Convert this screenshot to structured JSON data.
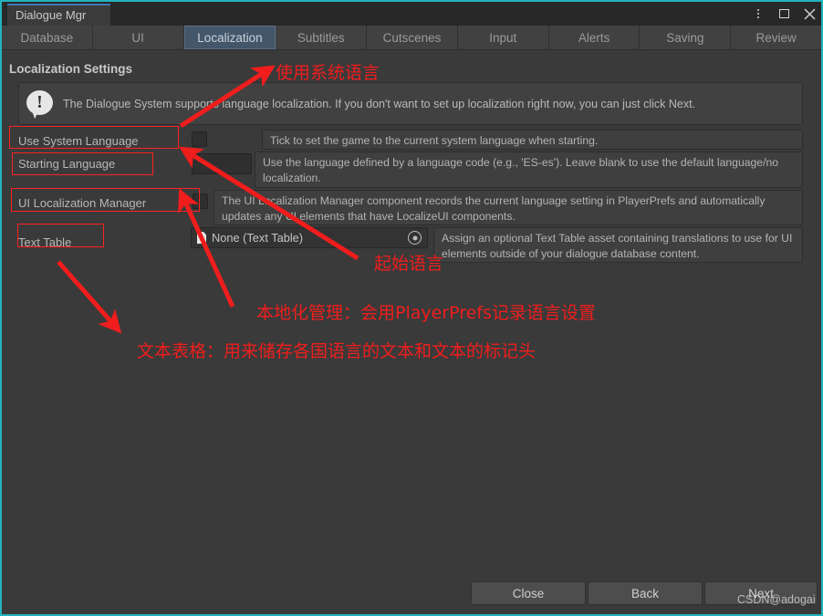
{
  "window": {
    "tab_title": "Dialogue Mgr",
    "controls": {
      "menu": "kebab-menu-icon",
      "maximize": "maximize-icon",
      "close": "close-icon"
    }
  },
  "tabs": [
    {
      "label": "Database",
      "active": false
    },
    {
      "label": "UI",
      "active": false
    },
    {
      "label": "Localization",
      "active": true
    },
    {
      "label": "Subtitles",
      "active": false
    },
    {
      "label": "Cutscenes",
      "active": false
    },
    {
      "label": "Input",
      "active": false
    },
    {
      "label": "Alerts",
      "active": false
    },
    {
      "label": "Saving",
      "active": false
    },
    {
      "label": "Review",
      "active": false
    }
  ],
  "main": {
    "section_title": "Localization Settings",
    "help": {
      "icon": "info-exclamation-icon",
      "text": "The Dialogue System supports language localization. If you don't want to set up localization right now, you can just click Next."
    },
    "rows": {
      "use_system_language": {
        "label": "Use System Language",
        "checked": false,
        "description": "Tick to set the game to the current system language when starting."
      },
      "starting_language": {
        "label": "Starting Language",
        "value": "",
        "description": "Use the language defined by a language code (e.g., 'ES-es'). Leave blank to use the default language/no localization."
      },
      "ui_localization_manager": {
        "label": "UI Localization Manager",
        "checked": false,
        "description": "The UI Localization Manager component records the current language setting in PlayerPrefs and automatically updates any UI elements that have LocalizeUI components."
      },
      "text_table": {
        "label": "Text Table",
        "value": "None (Text Table)",
        "picker_icon": "object-picker-icon",
        "asset_icon": "text-table-asset-icon",
        "description": "Assign an optional Text Table asset containing translations to use for UI elements outside of your dialogue database content."
      }
    }
  },
  "footer": {
    "buttons": [
      {
        "label": "Close"
      },
      {
        "label": "Back"
      },
      {
        "label": "Next"
      }
    ],
    "watermark": "CSDN@adogai"
  },
  "annotations": {
    "colors": {
      "red": "#f01d1d"
    },
    "notes": [
      {
        "text": "使用系统语言"
      },
      {
        "text": "起始语言"
      },
      {
        "text": "本地化管理：会用PlayerPrefs记录语言设置"
      },
      {
        "text": "文本表格：用来储存各国语言的文本和文本的标记头"
      }
    ]
  }
}
